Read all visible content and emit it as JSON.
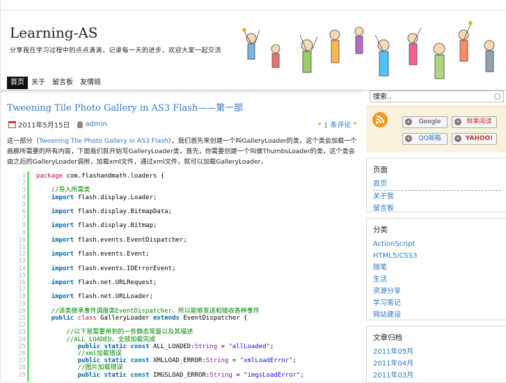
{
  "site": {
    "title": "Learning-AS",
    "description": "分享我在学习过程中的点点滴滴，记录每一天的进步，欢迎大家一起交流"
  },
  "nav": {
    "items": [
      "首页",
      "关于",
      "留言板",
      "友情链"
    ]
  },
  "post": {
    "title": "Tweening Tile Photo Gallery in AS3 Flash——第一部",
    "date": "2011年5月15日",
    "author": "admin",
    "comments": "1 条评论",
    "excerpt_lead": "这一部分（",
    "excerpt_link": "Tweening Tile Photo Gallery in AS3 Flash",
    "excerpt_rest": "），我们首先来创建一个叫GalleryLoader的类，这个类会加载一个画廊所需要的所有内容，下面我们就开始写GalleryLoader类，首先，你需要创建一个叫做ThumbsLoader的类，这个类会由之后的GalleryLoader调用，加载xml文件，通过xml文件，就可以加载GalleryLoader。"
  },
  "code_lines": [
    {
      "n": "1",
      "html": "<span class='kw2'>package</span> com.flashandmath.loaders {"
    },
    {
      "n": "2",
      "html": ""
    },
    {
      "n": "3",
      "html": "    <span class='cm'>//导入所需类</span>"
    },
    {
      "n": "4",
      "html": "    <span class='kw'>import</span> flash.display.Loader;"
    },
    {
      "n": "5",
      "html": ""
    },
    {
      "n": "6",
      "html": "    <span class='kw'>import</span> flash.display.BitmapData;"
    },
    {
      "n": "7",
      "html": ""
    },
    {
      "n": "8",
      "html": "    <span class='kw'>import</span> flash.display.Bitmap;"
    },
    {
      "n": "9",
      "html": ""
    },
    {
      "n": "10",
      "html": "    <span class='kw'>import</span> flash.events.EventDispatcher;"
    },
    {
      "n": "11",
      "html": ""
    },
    {
      "n": "12",
      "html": "    <span class='kw'>import</span> flash.events.Event;"
    },
    {
      "n": "13",
      "html": ""
    },
    {
      "n": "14",
      "html": "    <span class='kw'>import</span> flash.events.IOErrorEvent;"
    },
    {
      "n": "15",
      "html": ""
    },
    {
      "n": "16",
      "html": "    <span class='kw'>import</span> flash.net.URLRequest;"
    },
    {
      "n": "17",
      "html": ""
    },
    {
      "n": "18",
      "html": "    <span class='kw'>import</span> flash.net.URLLoader;"
    },
    {
      "n": "19",
      "html": ""
    },
    {
      "n": "20",
      "html": "    <span class='cm'>//该类继承事件调度类EventDispatcher，所以能够发送和接收各种事件</span>"
    },
    {
      "n": "21",
      "html": "    <span class='kw'>public</span> <span class='kw2'>class</span> GalleryLoader <span class='kw'>extends</span> EventDispatcher {"
    },
    {
      "n": "22",
      "html": ""
    },
    {
      "n": "23",
      "html": "        <span class='cm'>//以下是需要用到的一些静态常量以及其描述</span>"
    },
    {
      "n": "24",
      "html": "        <span class='cm'>//ALL_LOADED，全部加载完成</span>"
    },
    {
      "n": "25",
      "html": "           <span class='kw'>public</span> <span class='kw'>static</span> <span class='kw'>const</span> ALL_LOADED:<span class='tp'>String</span> = <span class='str'>\"allLoaded\"</span>;"
    },
    {
      "n": "26",
      "html": "           <span class='cm'>//xml加载错误</span>"
    },
    {
      "n": "27",
      "html": "           <span class='kw'>public</span> <span class='kw'>static</span> <span class='kw'>const</span> XMLLOAD_ERROR:<span class='tp'>String</span> = <span class='str'>\"xmlLoadError\"</span>;"
    },
    {
      "n": "28",
      "html": "           <span class='cm'>//图片加载错误</span>"
    },
    {
      "n": "29",
      "html": "           <span class='kw'>public</span> <span class='kw'>static</span> <span class='kw'>const</span> IMGSLOAD_ERROR:<span class='tp'>String</span> = <span class='str'>\"imgsLoadError\"</span>;"
    }
  ],
  "sidebar": {
    "search_value": "搜索..",
    "feeds": [
      "Google",
      "鲜果阅读",
      "QQ邮箱",
      "YAHOO!"
    ],
    "pages": {
      "title": "页面",
      "items": [
        "首页",
        "关于我",
        "留言板"
      ]
    },
    "categories": {
      "title": "分类",
      "items": [
        "ActionScript",
        "HTML5/CSS3",
        "随笔",
        "生活",
        "资源分享",
        "学习笔记",
        "网站建设"
      ]
    },
    "archives": {
      "title": "文章归档",
      "items": [
        "2011年05月",
        "2011年04月",
        "2011年03月"
      ]
    }
  },
  "colors": {
    "link": "#2f78c0",
    "accent_green": "#6ce26c",
    "feed_bg": "#f7f2dc"
  }
}
